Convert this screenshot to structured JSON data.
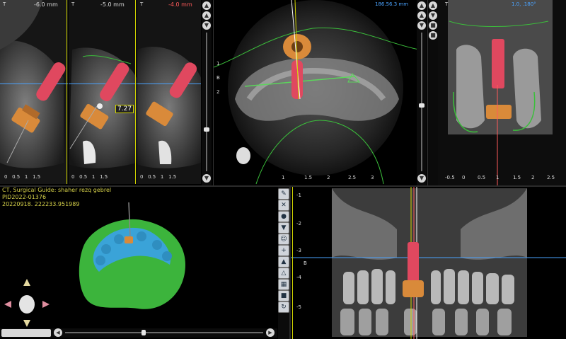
{
  "slices": [
    {
      "label": "-6.0 mm",
      "marker": "T"
    },
    {
      "label": "-5.0 mm",
      "marker": "T"
    },
    {
      "label": "-4.0 mm",
      "marker": "T"
    }
  ],
  "slice_ruler": [
    "0",
    "0.5",
    "1",
    "1.5"
  ],
  "slice_ruler_3": [
    "0",
    "0.5",
    "1",
    "1.5"
  ],
  "measure": "7.27",
  "axial": {
    "coord": "186.56.3 mm",
    "ruler": [
      "1",
      "1.5",
      "2",
      "2.5",
      "3"
    ],
    "left_ticks": [
      "1",
      "B",
      "2"
    ]
  },
  "pano_top": {
    "label": "1.0, .180°",
    "ruler": [
      "-0.5",
      "0",
      "0.5",
      "1",
      "1.5",
      "2",
      "2.5"
    ],
    "marker": "T"
  },
  "guide": {
    "line1": "CT, Surgical Guide: shaher rezq gebrel",
    "line2": "PID2022-01376",
    "line3": "20220918. 222233.951989"
  },
  "coronal": {
    "ruler": [
      "-1",
      "-2",
      "-3",
      "-4",
      "-5"
    ],
    "left_ticks": [
      "-1",
      "-2",
      "-3",
      "B",
      "-4",
      "-5"
    ]
  },
  "scroll_buttons": {
    "up": "▲",
    "down": "▼",
    "left": "◀",
    "right": "▶"
  },
  "colors": {
    "implant": "#e0485f",
    "sleeve": "#d98a3a",
    "outline": "#3bbf3b",
    "gum": "#3cb43c",
    "teeth": "#3aa3d8",
    "guide_text": "#d7d24a",
    "crosshair": "#4aa3ff"
  }
}
